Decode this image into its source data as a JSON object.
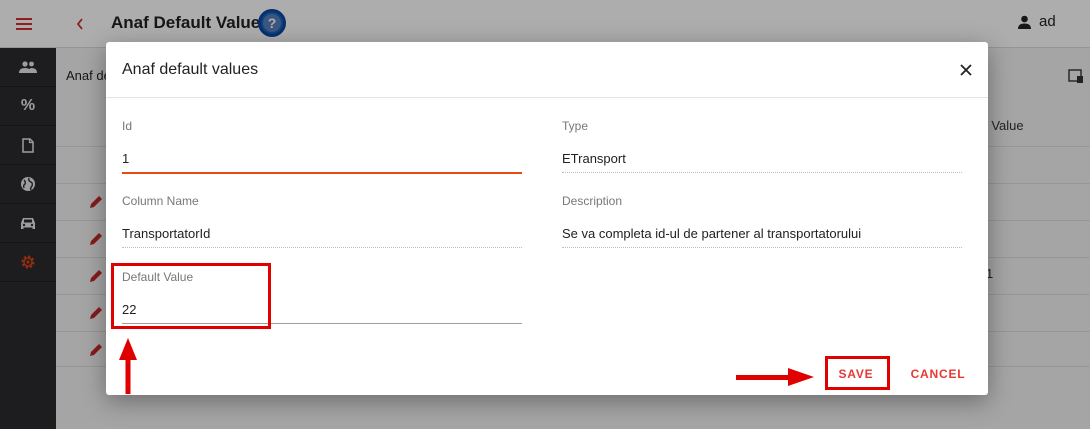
{
  "app": {
    "title": "Anaf Default Values",
    "user_name": "ad",
    "content_label": "Anaf de",
    "column_header": "ult Value",
    "row_partial_text": "1"
  },
  "sidebar": {
    "items": [
      {
        "icon": "users-icon"
      },
      {
        "icon": "percent-icon",
        "label": "%"
      },
      {
        "icon": "document-icon"
      },
      {
        "icon": "globe-icon"
      },
      {
        "icon": "car-icon"
      },
      {
        "icon": "gear-icon",
        "active": true
      }
    ]
  },
  "dialog": {
    "title": "Anaf default values",
    "fields": {
      "id": {
        "label": "Id",
        "value": "1"
      },
      "type": {
        "label": "Type",
        "value": "ETransport"
      },
      "column_name": {
        "label": "Column Name",
        "value": "TransportatorId"
      },
      "description": {
        "label": "Description",
        "value": "Se va completa id-ul de partener al transportatorului"
      },
      "default_value": {
        "label": "Default Value",
        "value": "22"
      }
    },
    "save_label": "SAVE",
    "cancel_label": "CANCEL"
  },
  "colors": {
    "accent": "#e53935",
    "focus_underline": "#e64a19",
    "annotation": "#e00000",
    "sidebar_bg": "#2c2c30",
    "help_icon": "#1565c0"
  }
}
